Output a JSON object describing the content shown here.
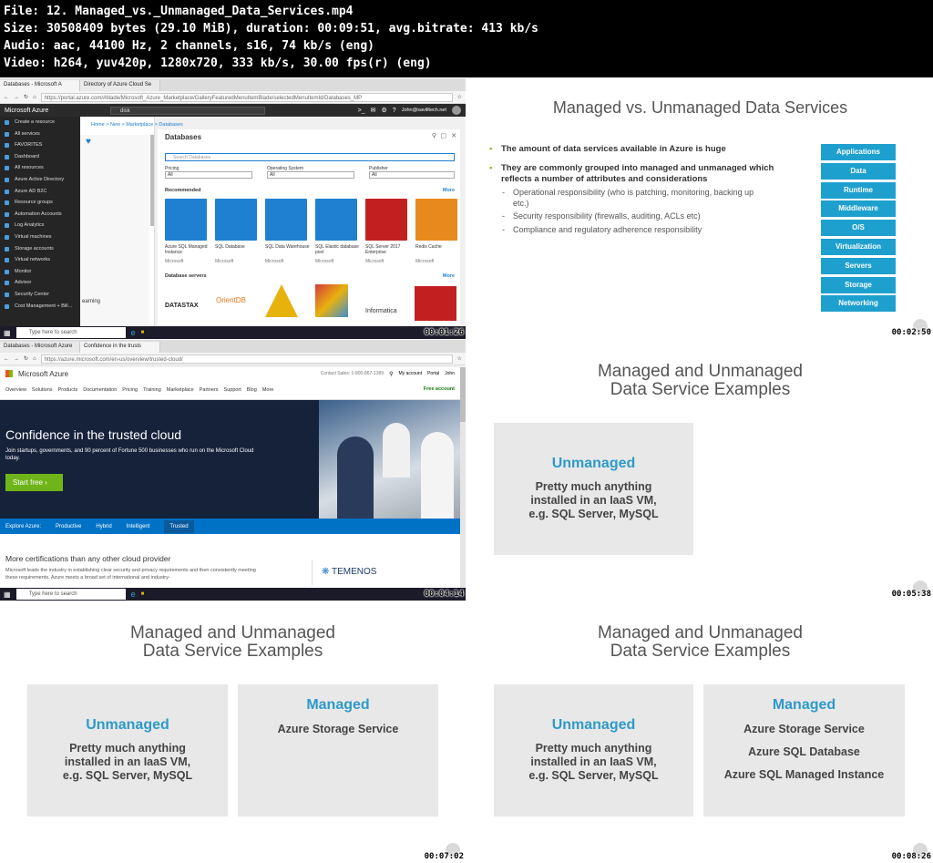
{
  "header": {
    "line1": "File: 12. Managed_vs._Unmanaged_Data_Services.mp4",
    "line2": "Size: 30508409 bytes (29.10 MiB), duration: 00:09:51, avg.bitrate: 413 kb/s",
    "line3": "Audio: aac, 44100 Hz, 2 channels, s16, 74 kb/s (eng)",
    "line4": "Video: h264, yuv420p, 1280x720, 333 kb/s, 30.00 fps(r) (eng)"
  },
  "timestamps": [
    "00:01:26",
    "00:02:50",
    "00:04:14",
    "00:05:38",
    "00:07:02",
    "00:08:26"
  ],
  "frame1": {
    "tab1": "Databases - Microsoft A",
    "tab2": "Directory of Azure Cloud Se",
    "url": "https://portal.azure.com/#blade/Microsoft_Azure_Marketplace/GalleryFeaturedMenuItemBlade/selectedMenuItemId/Databases_MP",
    "brand": "Microsoft Azure",
    "search": "disk",
    "user": "John@savilltech.net",
    "org": "SAVILLTECH",
    "breadcrumb": "Home > New > Marketplace > Databases",
    "blade_title": "Databases",
    "search_databases": "Search Databases",
    "filter_pricing": "Pricing",
    "filter_os": "Operating System",
    "filter_publisher": "Publisher",
    "all": "All",
    "recommended": "Recommended",
    "more": "More",
    "database_servers": "Database servers",
    "learning": "earning",
    "sidebar": [
      "Create a resource",
      "All services",
      "FAVORITES",
      "Dashboard",
      "All resources",
      "Azure Active Directory",
      "Azure AD B2C",
      "Resource groups",
      "Automation Accounts",
      "Log Analytics",
      "Virtual machines",
      "Storage accounts",
      "Virtual networks",
      "Monitor",
      "Advisor",
      "Security Center",
      "Cost Management + Bill..."
    ],
    "tiles": [
      {
        "name": "Azure SQL Managed Instance",
        "pub": "Microsoft",
        "color": "#1f7fd0"
      },
      {
        "name": "SQL Database",
        "pub": "Microsoft",
        "color": "#1f7fd0"
      },
      {
        "name": "SQL Data Warehouse",
        "pub": "Microsoft",
        "color": "#1f7fd0"
      },
      {
        "name": "SQL Elastic database pool",
        "pub": "Microsoft",
        "color": "#1f7fd0"
      },
      {
        "name": "SQL Server 2017 Enterprise",
        "pub": "Microsoft",
        "color": "#c22020"
      },
      {
        "name": "Redis Cache",
        "pub": "Microsoft",
        "color": "#e8891d"
      }
    ],
    "servers": [
      "DATASTAX",
      "OrientDB",
      "",
      "",
      "Informatica",
      ""
    ],
    "taskbar_search": "Type here to search"
  },
  "frame2": {
    "title": "Managed vs. Unmanaged Data Services",
    "bullet1": "The amount of data services available in Azure is huge",
    "bullet2": "They are commonly grouped into managed and unmanaged which reflects a number of attributes and considerations",
    "sub1": "Operational responsibility (who is patching, monitoring, backing up etc.)",
    "sub2": "Security responsibility (firewalls, auditing, ACLs etc)",
    "sub3": "Compliance and regulatory adherence responsibility",
    "layers": [
      "Applications",
      "Data",
      "Runtime",
      "Middleware",
      "O/S",
      "Virtualization",
      "Servers",
      "Storage",
      "Networking"
    ]
  },
  "frame3": {
    "tab1": "Databases - Microsoft Azure",
    "tab2": "Confidence in the trusts",
    "url": "https://azure.microsoft.com/en-us/overview/trusted-cloud/",
    "brand": "Microsoft Azure",
    "contact": "Contact Sales: 1-800-867-1389",
    "my_account": "My account",
    "portal": "Portal",
    "user": "John",
    "nav": [
      "Overview",
      "Solutions",
      "Products",
      "Documentation",
      "Pricing",
      "Training",
      "Marketplace",
      "Partners",
      "Support",
      "Blog",
      "More"
    ],
    "free_account": "Free account",
    "hero_title": "Confidence in the trusted cloud",
    "hero_text": "Join startups, governments, and 90 percent of Fortune 500 businesses who run on the Microsoft Cloud today.",
    "start_free": "Start free",
    "explore": "Explore Azure:",
    "explore_tabs": [
      "Productive",
      "Hybrid",
      "Intelligent",
      "Trusted"
    ],
    "cert_title": "More certifications than any other cloud provider",
    "cert_text": "Microsoft leads the industry in establishing clear security and privacy requirements and then consistently meeting these requirements. Azure meets a broad set of international and industry-",
    "temenos": "TEMENOS",
    "taskbar_search": "Type here to search"
  },
  "slides": {
    "title1": "Managed and Unmanaged",
    "title2": "Data Service Examples",
    "unmanaged_heading": "Unmanaged",
    "unmanaged_lines": [
      "Pretty much anything",
      "installed in an IaaS VM,",
      "e.g. SQL Server, MySQL"
    ],
    "managed_heading": "Managed",
    "managed_items": [
      "Azure Storage Service",
      "Azure SQL Database",
      "Azure SQL Managed Instance"
    ]
  }
}
